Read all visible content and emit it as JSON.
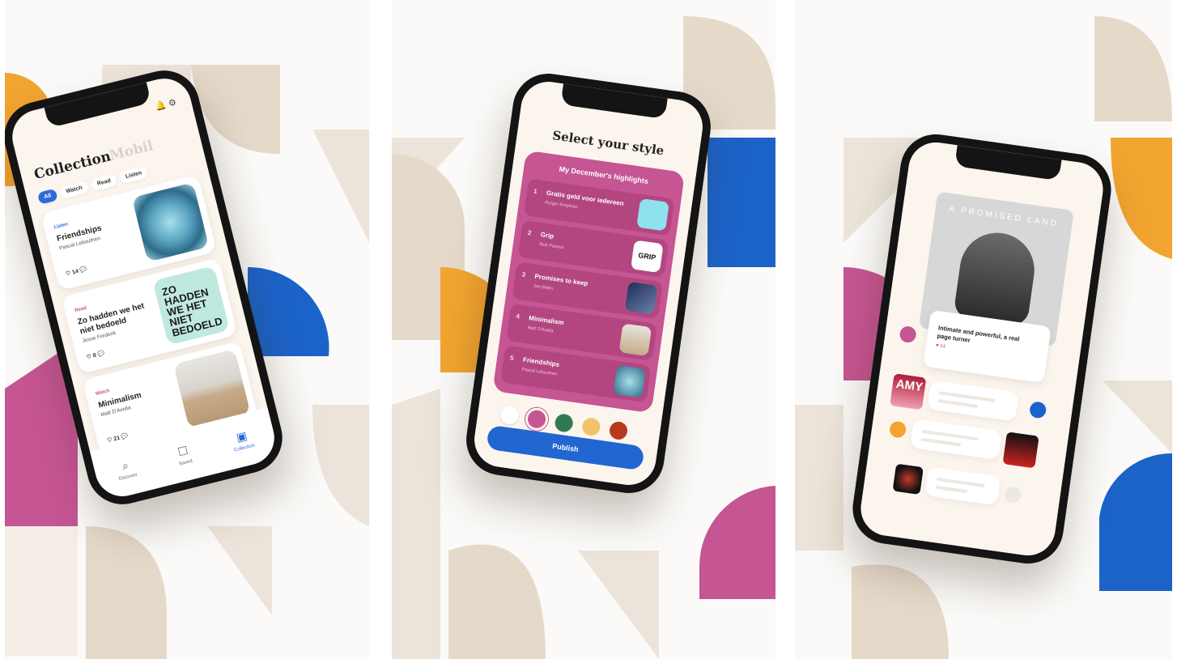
{
  "phone1": {
    "heading": "Collection",
    "heading_secondary": "Mobil",
    "filters": [
      "All",
      "Watch",
      "Read",
      "Listen"
    ],
    "items": [
      {
        "type": "Listen",
        "title": "Friendships",
        "author": "Pascal Lebouthen",
        "likes": "14",
        "comments": ""
      },
      {
        "type": "Read",
        "title": "Zo hadden we het niet bedoeld",
        "author": "Jesse Frederik",
        "likes": "8",
        "comments": ""
      },
      {
        "type": "Watch",
        "title": "Minimalism",
        "author": "Matt D'Avella",
        "likes": "21",
        "comments": ""
      }
    ],
    "thumb2_text": "ZO HADDEN WE HET NIET BEDOELD",
    "nav": [
      {
        "label": "Discover",
        "icon": "search-icon"
      },
      {
        "label": "Saved",
        "icon": "bookmark-icon"
      },
      {
        "label": "Collection",
        "icon": "collection-icon"
      }
    ]
  },
  "phone2": {
    "heading": "Select your style",
    "box_title": "My December's highlights",
    "items": [
      {
        "n": "1",
        "title": "Gratis geld voor iedereen",
        "author": "Rutger Bregman"
      },
      {
        "n": "2",
        "title": "Grip",
        "author": "Rick Pastoor"
      },
      {
        "n": "3",
        "title": "Promises to keep",
        "author": "Joe Biden"
      },
      {
        "n": "4",
        "title": "Minimalism",
        "author": "Matt D'Avella"
      },
      {
        "n": "5",
        "title": "Friendships",
        "author": "Pascal Lebouthen"
      }
    ],
    "grip_text": "GRIP",
    "swatches": [
      "#ffffff",
      "#c55593",
      "#2f7a55",
      "#f2c36b",
      "#b8391f"
    ],
    "button": "Publish"
  },
  "phone3": {
    "book_title": "A PROMISED LAND",
    "quote": "Intimate and powerful, a real page turner",
    "quote_likes": "14",
    "amy_text": "AMY"
  },
  "colors": {
    "accent": "#2166d1",
    "pink": "#c55593",
    "orange": "#f2a430",
    "beige": "#e8dccd"
  }
}
